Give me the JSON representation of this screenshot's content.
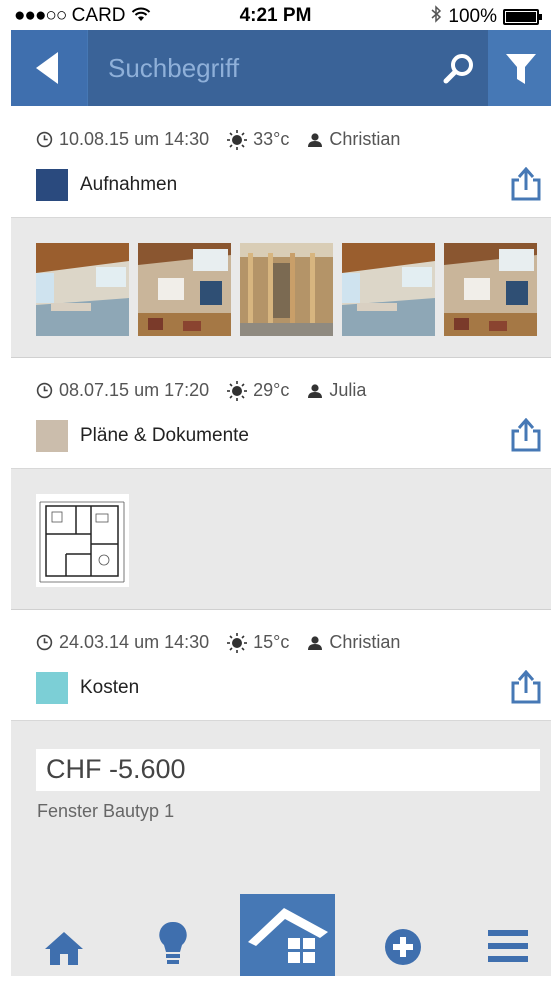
{
  "status_bar": {
    "signal": "●●●○○",
    "carrier": "CARD",
    "time": "4:21 PM",
    "battery": "100%"
  },
  "nav": {
    "search_placeholder": "Suchbegriff"
  },
  "entries": [
    {
      "date": "10.08.15 um 14:30",
      "temp": "33°c",
      "user": "Christian",
      "category": "Aufnahmen",
      "color": "#2a4a7e"
    },
    {
      "date": "08.07.15 um 17:20",
      "temp": "29°c",
      "user": "Julia",
      "category": "Pläne & Dokumente",
      "color": "#cbbdac"
    },
    {
      "date": "24.03.14 um 14:30",
      "temp": "15°c",
      "user": "Christian",
      "category": "Kosten",
      "color": "#7ccfd6",
      "amount": "CHF -5.600",
      "description": "Fenster Bautyp 1"
    }
  ],
  "icons": {
    "accent": "#4678b5",
    "tabs": [
      "home-icon",
      "lightbulb-icon",
      "house-icon",
      "plus-circle-icon",
      "menu-icon"
    ]
  }
}
